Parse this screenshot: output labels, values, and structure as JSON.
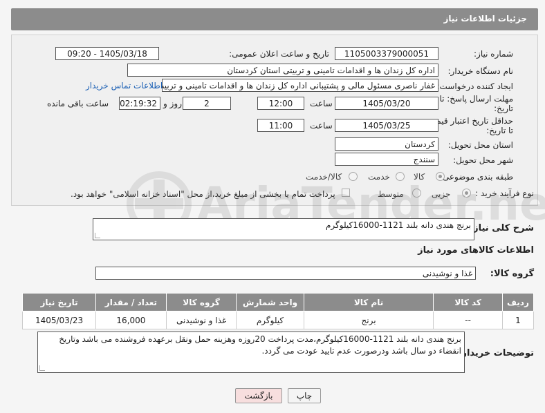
{
  "header": {
    "title": "جزئیات اطلاعات نیاز"
  },
  "form": {
    "need_number_label": "شماره نیاز:",
    "need_number": "1105003379000051",
    "announce_label": "تاریخ و ساعت اعلان عمومی:",
    "announce_value": "1405/03/18 - 09:20",
    "buyer_org_label": "نام دستگاه خریدار:",
    "buyer_org": "اداره کل زندان ها و اقدامات تامینی و تربیتی استان کردستان",
    "creator_label": "ایجاد کننده درخواست:",
    "creator": "غفار ناصری مسئول مالی و پشتیبانی اداره کل زندان ها و اقدامات تامینی و تربیت",
    "contact_link": "اطلاعات تماس خریدار",
    "reply_deadline_label_1": "مهلت ارسال پاسخ: تا",
    "reply_deadline_label_2": "تاریخ:",
    "reply_date": "1405/03/20",
    "time_label": "ساعت",
    "reply_time": "12:00",
    "days_count": "2",
    "day_and_label": "روز و",
    "remaining_time": "02:19:32",
    "remaining_label": "ساعت باقی مانده",
    "price_validity_label_1": "حداقل تاریخ اعتبار قیمت:",
    "price_validity_label_2": "تا تاریخ:",
    "price_date": "1405/03/25",
    "price_time_label": "ساعت",
    "price_time": "11:00",
    "province_label": "استان محل تحویل:",
    "province": "کردستان",
    "city_label": "شهر محل تحویل:",
    "city": "سنندج",
    "category_label": "طبقه بندی موضوعی:",
    "category_options": [
      "کالا",
      "خدمت",
      "کالا/خدمت"
    ],
    "process_label": "نوع فرآیند خرید :",
    "process_options": [
      "جزیی",
      "متوسط"
    ],
    "process_note": "پرداخت تمام یا بخشی از مبلغ خرید،از محل \"اسناد خزانه اسلامی\" خواهد بود."
  },
  "summary": {
    "label": "شرح کلی نیاز:",
    "value": "برنج هندی دانه بلند 1121-16000کیلوگرم"
  },
  "goods_section": {
    "title": "اطلاعات کالاهای مورد نیاز",
    "group_label": "گروه کالا:",
    "group_value": "غذا و نوشیدنی"
  },
  "table": {
    "headers": [
      "ردیف",
      "کد کالا",
      "نام کالا",
      "واحد شمارش",
      "گروه کالا",
      "تعداد / مقدار",
      "تاریخ نیاز"
    ],
    "rows": [
      [
        "1",
        "--",
        "برنج",
        "کیلوگرم",
        "غذا و نوشیدنی",
        "16,000",
        "1405/03/23"
      ]
    ]
  },
  "buyer_notes": {
    "label": "توضیحات خریدار:",
    "value": "برنج هندی دانه بلند 1121-16000کیلوگرم،مدت پرداخت 20روزه وهزینه حمل ونقل برعهده فروشنده می باشد وتاریخ انقضاء دو سال باشد ودرصورت عدم تایید عودت می گردد."
  },
  "buttons": {
    "print": "چاپ",
    "back": "بازگشت"
  },
  "watermark": {
    "text": "AriaTender.neT"
  },
  "colors": {
    "header": "#8c8c8c",
    "link": "#1a5fb4",
    "back_button": "#f7dede"
  }
}
